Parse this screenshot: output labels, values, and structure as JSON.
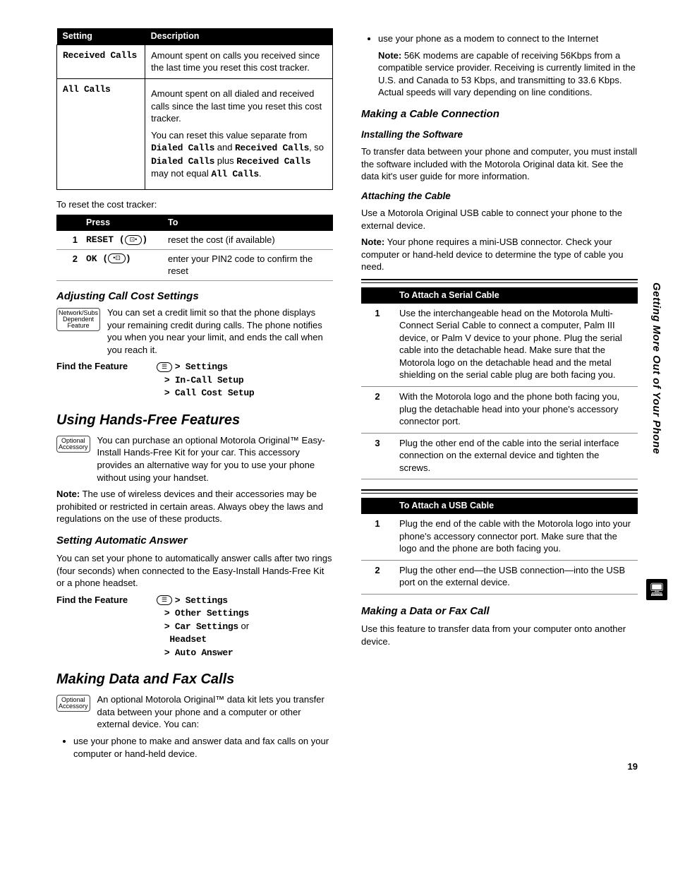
{
  "sideTitle": "Getting More Out of Your Phone",
  "pageNumber": "19",
  "left": {
    "table1": {
      "headers": [
        "Setting",
        "Description"
      ],
      "rows": [
        {
          "setting": "Received Calls",
          "desc": "Amount spent on calls you received since the last time you reset this cost tracker."
        },
        {
          "setting": "All Calls",
          "descIntro": "Amount spent on all dialed and received calls since the last time you reset this cost tracker.",
          "descPara2_a": "You can reset this value separate from ",
          "descPara2_b": "Dialed Calls",
          "descPara2_c": " and ",
          "descPara2_d": "Received Calls",
          "descPara2_e": ", so ",
          "descPara2_f": "Dialed Calls",
          "descPara2_g": " plus ",
          "descPara2_h": "Received Calls",
          "descPara2_i": " may not equal ",
          "descPara2_j": "All Calls",
          "descPara2_k": "."
        }
      ]
    },
    "resetIntro": "To reset the cost tracker:",
    "table2": {
      "headers": [
        "",
        "Press",
        "To"
      ],
      "rows": [
        {
          "num": "1",
          "press": "RESET",
          "to": "reset the cost (if available)"
        },
        {
          "num": "2",
          "press": "OK",
          "to": "enter your PIN2 code to confirm the reset"
        }
      ]
    },
    "adjusting": {
      "title": "Adjusting Call Cost Settings",
      "body": "You can set a credit limit so that the phone displays your remaining credit during calls. The phone notifies you when you near your limit, and ends the call when you reach it.",
      "findLabel": "Find the Feature",
      "path1": "> Settings",
      "path2": "> In-Call Setup",
      "path3": "> Call Cost Setup"
    },
    "handsFree": {
      "title": "Using Hands-Free Features",
      "body": "You can purchase an optional Motorola Original™ Easy-Install Hands-Free Kit for your car. This accessory provides an alternative way for you to use your phone without using your handset.",
      "noteLabel": "Note:",
      "note": " The use of wireless devices and their accessories may be prohibited or restricted in certain areas. Always obey the laws and regulations on the use of these products."
    },
    "autoAnswer": {
      "title": "Setting Automatic Answer",
      "body": "You can set your phone to automatically answer calls after two rings (four seconds) when connected to the Easy-Install Hands-Free Kit or a phone headset.",
      "findLabel": "Find the Feature",
      "path1": "> Settings",
      "path2": "> Other Settings",
      "path3a": "> Car Settings",
      "path3b": " or",
      "path4": "   Headset",
      "path5": "> Auto Answer"
    },
    "dataFax": {
      "title": "Making Data and Fax Calls",
      "body": "An optional Motorola Original™ data kit lets you transfer data between your phone and a computer or other external device. You can:",
      "bullet1": "use your phone to make and answer data and fax calls on your computer or hand-held device."
    }
  },
  "right": {
    "bullet2": "use your phone as a modem to connect to the Internet",
    "noteLabel": "Note:",
    "noteBody": " 56K modems are capable of receiving 56Kbps from a compatible service provider. Receiving is currently limited in the U.S. and Canada to 53 Kbps, and transmitting to 33.6 Kbps. Actual speeds will vary depending on line conditions.",
    "cableConn": {
      "title": "Making a Cable Connection",
      "installTitle": "Installing the Software",
      "installBody": "To transfer data between your phone and computer, you must install the software included with the Motorola Original data kit. See the data kit's user guide for more information.",
      "attachTitle": "Attaching the Cable",
      "attachBody1": "Use a Motorola Original USB cable to connect your phone to the external device.",
      "attachNoteLabel": "Note:",
      "attachNoteBody": " Your phone requires a mini-USB connector. Check your computer or hand-held device to determine the type of cable you need."
    },
    "serialTable": {
      "header": "To Attach a Serial Cable",
      "rows": [
        {
          "num": "1",
          "text": "Use the interchangeable head on the Motorola Multi-Connect Serial Cable to connect a computer, Palm III device, or Palm V device to your phone. Plug the serial cable into the detachable head. Make sure that the Motorola logo on the detachable head and the metal shielding on the serial cable plug are both facing you."
        },
        {
          "num": "2",
          "text": "With the Motorola logo and the phone both facing you, plug the detachable head into your phone's accessory connector port."
        },
        {
          "num": "3",
          "text": "Plug the other end of the cable into the serial interface connection on the external device and tighten the screws."
        }
      ]
    },
    "usbTable": {
      "header": "To Attach a USB Cable",
      "rows": [
        {
          "num": "1",
          "text": "Plug the end of the cable with the Motorola logo into your phone's accessory connector port. Make sure that the logo and the phone are both facing you."
        },
        {
          "num": "2",
          "text": "Plug the other end—the USB connection—into the USB port on the external device."
        }
      ]
    },
    "dataCall": {
      "title": "Making a Data or Fax Call",
      "body": "Use this feature to transfer data from your computer onto another device."
    }
  }
}
